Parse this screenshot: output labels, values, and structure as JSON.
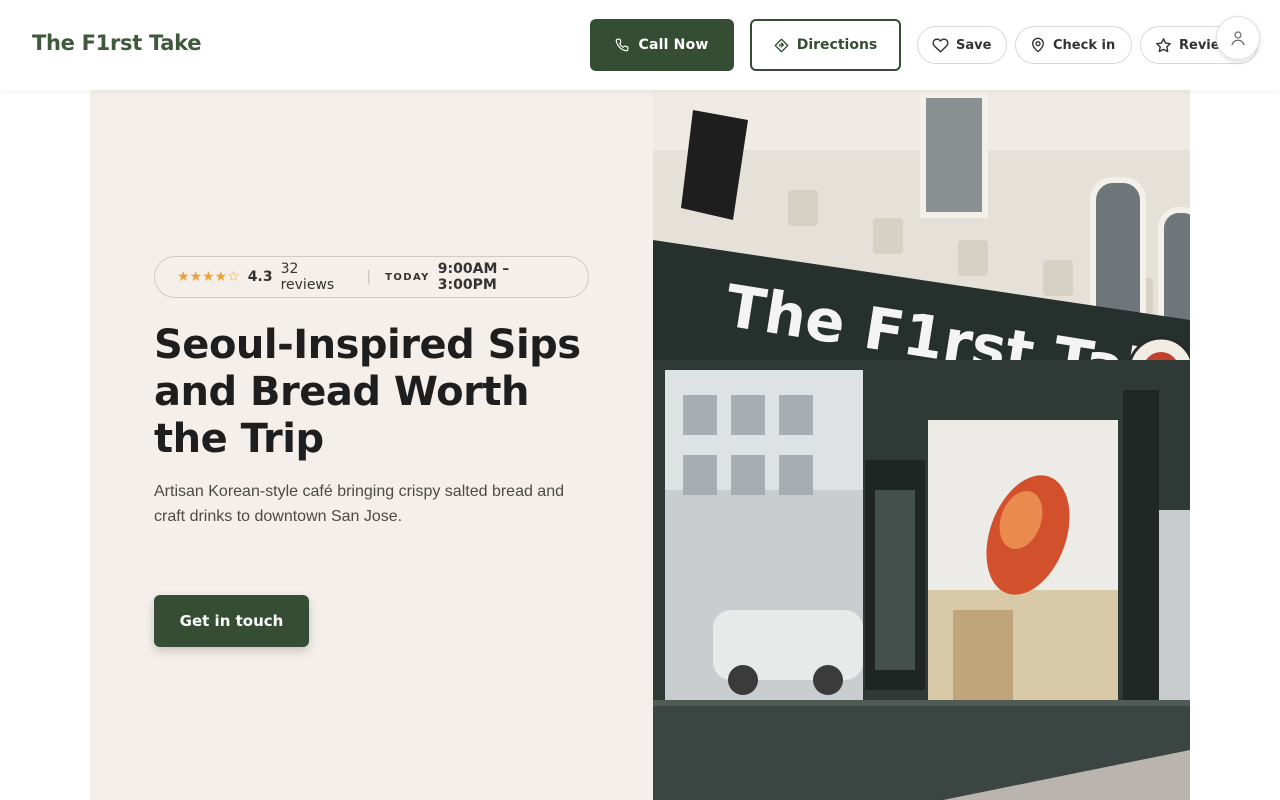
{
  "header": {
    "brand": "The F1rst Take",
    "call_label": "Call Now",
    "directions_label": "Directions",
    "save_label": "Save",
    "checkin_label": "Check in",
    "review_label": "Review"
  },
  "hero": {
    "stars": "★★★★☆",
    "rating": "4.3",
    "reviews": "32 reviews",
    "today_label": "TODAY",
    "hours": "9:00AM – 3:00PM",
    "headline": "Seoul-Inspired Sips and Bread Worth the Trip",
    "subtext": "Artisan Korean-style café bringing crispy salted bread and craft drinks to downtown San Jose.",
    "cta_label": "Get in touch",
    "storefront_sign": "The F1rst Take"
  },
  "colors": {
    "brand_green": "#344d33",
    "star_color": "#e8a43a",
    "hero_bg": "#f4efea"
  },
  "icons": [
    "phone-icon",
    "directions-icon",
    "heart-icon",
    "location-pin-icon",
    "star-icon",
    "user-icon"
  ]
}
